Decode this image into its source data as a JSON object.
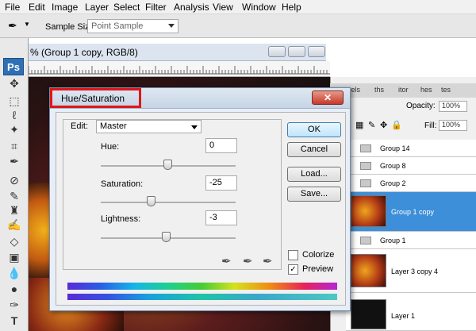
{
  "menubar": {
    "items": [
      "File",
      "Edit",
      "Image",
      "Layer",
      "Select",
      "Filter",
      "Analysis",
      "View",
      "Window",
      "Help"
    ]
  },
  "options": {
    "sample_size_label": "Sample Size:",
    "sample_size_value": "Point Sample",
    "tool_icon": "eyedropper-icon"
  },
  "toolbox": {
    "logo": "Ps",
    "tools": [
      "move-icon",
      "marquee-icon",
      "lasso-icon",
      "magic-wand-icon",
      "crop-icon",
      "eyedropper-icon",
      "healing-brush-icon",
      "brush-icon",
      "stamp-icon",
      "history-brush-icon",
      "eraser-icon",
      "gradient-icon",
      "blur-icon",
      "dodge-icon",
      "pen-icon",
      "type-icon"
    ]
  },
  "document": {
    "title": "% (Group 1 copy, RGB/8)"
  },
  "layers": {
    "tabs": [
      "rs",
      "yels",
      "ths",
      "itor",
      "hes",
      "tes"
    ],
    "opacity_label": "Opacity:",
    "opacity_value": "100%",
    "fill_label": "Fill:",
    "fill_value": "100%",
    "rows": [
      {
        "name": "Group 14",
        "type": "group"
      },
      {
        "name": "Group 8",
        "type": "group"
      },
      {
        "name": "Group 2",
        "type": "group"
      },
      {
        "name": "Group 1 copy",
        "type": "layer",
        "selected": true
      },
      {
        "name": "Group 1",
        "type": "group"
      },
      {
        "name": "Layer 3 copy 4",
        "type": "layer"
      },
      {
        "name": "Layer 1",
        "type": "layer"
      }
    ]
  },
  "dialog": {
    "title": "Hue/Saturation",
    "edit_label": "Edit:",
    "edit_value": "Master",
    "hue_label": "Hue:",
    "hue_value": "0",
    "saturation_label": "Saturation:",
    "saturation_value": "-25",
    "lightness_label": "Lightness:",
    "lightness_value": "-3",
    "ok_label": "OK",
    "cancel_label": "Cancel",
    "load_label": "Load...",
    "save_label": "Save...",
    "colorize_label": "Colorize",
    "preview_label": "Preview",
    "colorize_checked": false,
    "preview_checked": true
  }
}
